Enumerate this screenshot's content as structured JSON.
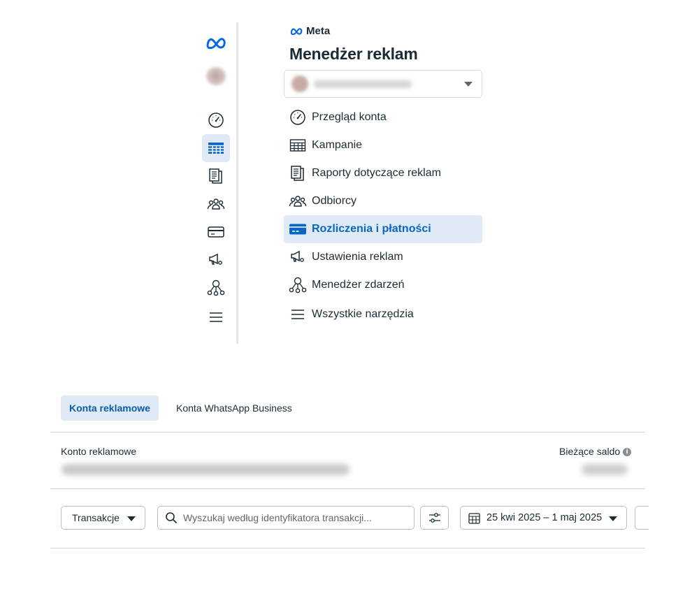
{
  "brand": {
    "name": "Meta"
  },
  "header": {
    "title": "Menedżer reklam"
  },
  "account_selector": {
    "name": "Chfghdwro Szibowa"
  },
  "menu": {
    "items": [
      {
        "label": "Przegląd konta",
        "icon": "dashboard-gauge-icon",
        "active": false
      },
      {
        "label": "Kampanie",
        "icon": "table-grid-icon",
        "active": false
      },
      {
        "label": "Raporty dotyczące reklam",
        "icon": "reports-icon",
        "active": false
      },
      {
        "label": "Odbiorcy",
        "icon": "audience-icon",
        "active": false
      },
      {
        "label": "Rozliczenia i płatności",
        "icon": "credit-card-icon",
        "active": true
      },
      {
        "label": "Ustawienia reklam",
        "icon": "megaphone-settings-icon",
        "active": false
      },
      {
        "label": "Menedżer zdarzeń",
        "icon": "events-tree-icon",
        "active": false
      },
      {
        "label": "Wszystkie narzędzia",
        "icon": "hamburger-menu-icon",
        "active": false
      }
    ]
  },
  "colors": {
    "accent": "#0a66c2",
    "active_bg": "#dfeaf6",
    "meta_blue": "#0668e1",
    "text": "#1c2b33"
  },
  "tabs": [
    {
      "label": "Konta reklamowe",
      "active": true
    },
    {
      "label": "Konta WhatsApp Business",
      "active": false
    }
  ],
  "account_info": {
    "account_label": "Konto reklamowe",
    "account_value": "Chfghdwro Szibowa (402647793412)",
    "balance_label": "Bieżące saldo",
    "balance_value": "0,00 zł"
  },
  "toolbar": {
    "type_select": "Transakcje",
    "search_placeholder": "Wyszukaj według identyfikatora transakcji...",
    "date_range": "25 kwi 2025 – 1 maj 2025"
  }
}
